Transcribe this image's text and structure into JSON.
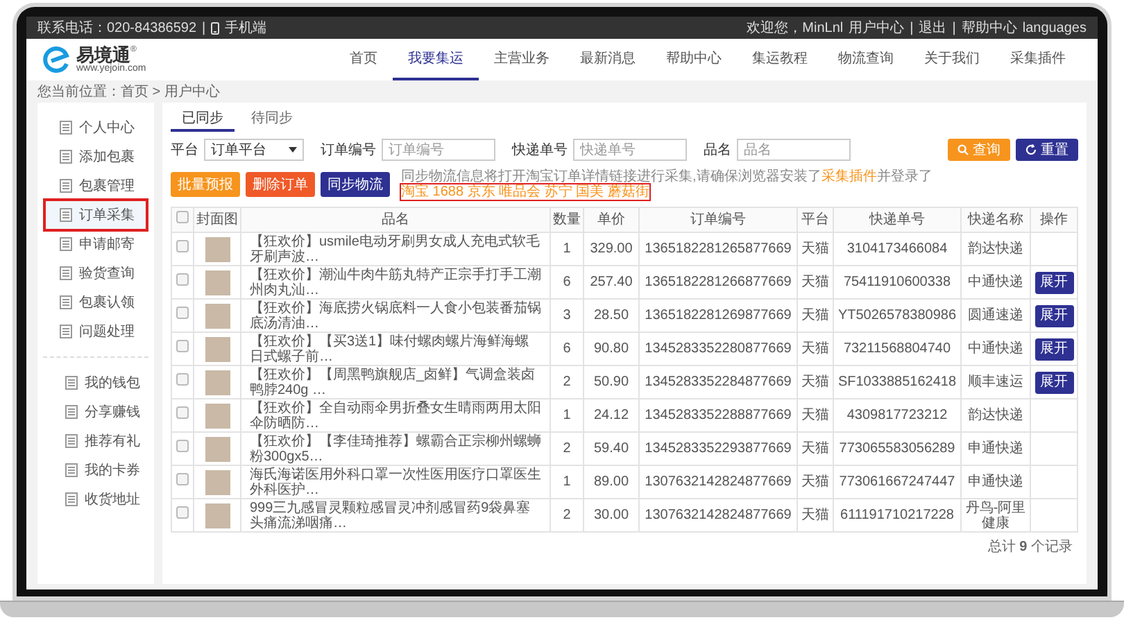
{
  "top_bar": {
    "contact": "联系电话：020-84386592",
    "separator": "|",
    "mobile": "手机端",
    "welcome": "欢迎您，MinLnl",
    "links": [
      {
        "label": "用户中心"
      },
      {
        "label": "退出"
      },
      {
        "label": "帮助中心"
      }
    ],
    "languages": "languages"
  },
  "logo": {
    "name": "易境通",
    "registered": "®",
    "url": "www.yejoin.com"
  },
  "nav": [
    {
      "label": "首页",
      "selected": false
    },
    {
      "label": "我要集运",
      "selected": true
    },
    {
      "label": "主营业务",
      "selected": false
    },
    {
      "label": "最新消息",
      "selected": false
    },
    {
      "label": "帮助中心",
      "selected": false
    },
    {
      "label": "集运教程",
      "selected": false
    },
    {
      "label": "物流查询",
      "selected": false
    },
    {
      "label": "关于我们",
      "selected": false
    },
    {
      "label": "采集插件",
      "selected": false
    }
  ],
  "breadcrumb": "您当前位置：首页 > 用户中心",
  "sidebar": {
    "groups": [
      [
        {
          "label": "个人中心",
          "selected": false
        },
        {
          "label": "添加包裹",
          "selected": false
        },
        {
          "label": "包裹管理",
          "selected": false
        },
        {
          "label": "订单采集",
          "selected": true
        },
        {
          "label": "申请邮寄",
          "selected": false
        },
        {
          "label": "验货查询",
          "selected": false
        },
        {
          "label": "包裹认领",
          "selected": false
        },
        {
          "label": "问题处理",
          "selected": false
        }
      ],
      [
        {
          "label": "我的钱包",
          "selected": false
        },
        {
          "label": "分享赚钱",
          "selected": false
        },
        {
          "label": "推荐有礼",
          "selected": false
        },
        {
          "label": "我的卡券",
          "selected": false
        },
        {
          "label": "收货地址",
          "selected": false
        }
      ]
    ]
  },
  "tabs": [
    {
      "label": "已同步",
      "selected": true
    },
    {
      "label": "待同步",
      "selected": false
    }
  ],
  "filters": {
    "platform": {
      "label": "平台",
      "value": "订单平台"
    },
    "fields": [
      {
        "label": "订单编号",
        "placeholder": "订单编号"
      },
      {
        "label": "快递单号",
        "placeholder": "快递单号"
      },
      {
        "label": "品名",
        "placeholder": "品名"
      }
    ],
    "search_button": "查询",
    "reset_button": "重置"
  },
  "actions": [
    {
      "label": "批量预报",
      "color": "#f7941d"
    },
    {
      "label": "删除订单",
      "color": "#f05a28"
    },
    {
      "label": "同步物流",
      "color": "#2e3192"
    }
  ],
  "note": {
    "text": "同步物流信息将打开淘宝订单详情链接进行采集,请确保浏览器安装了",
    "link": "采集插件",
    "text_2": "并登录了",
    "platforms": "淘宝 1688 京东 唯品会 苏宁 国美 蘑菇街"
  },
  "table": {
    "columns": [
      "封面图",
      "品名",
      "数量",
      "单价",
      "订单编号",
      "平台",
      "快递单号",
      "快递名称",
      "操作"
    ],
    "header_checked": false,
    "rows": [
      {
        "checked": false,
        "name": "【狂欢价】usmile电动牙刷男女成人充电式软毛牙刷声波…",
        "qty": "1",
        "price": "329.00",
        "order_no": "1365182281265877669",
        "platform": "天猫",
        "tracking": "3104173466084",
        "courier": "韵达快递"
      },
      {
        "checked": false,
        "name": "【狂欢价】潮汕牛肉牛筋丸特产正宗手打手工潮州肉丸汕…",
        "qty": "6",
        "price": "257.40",
        "order_no": "1365182281266877669",
        "platform": "天猫",
        "tracking": "75411910600338",
        "courier": "中通快递",
        "action": "展开"
      },
      {
        "checked": false,
        "name": "【狂欢价】海底捞火锅底料一人食小包装番茄锅底汤清油…",
        "qty": "3",
        "price": "28.50",
        "order_no": "1365182281269877669",
        "platform": "天猫",
        "tracking": "YT5026578380986",
        "courier": "圆通速递",
        "action": "展开"
      },
      {
        "checked": false,
        "name": "【狂欢价】【买3送1】味付螺肉螺片海鲜海螺日式螺子前…",
        "qty": "6",
        "price": "90.80",
        "order_no": "1345283352280877669",
        "platform": "天猫",
        "tracking": "73211568804740",
        "courier": "中通快递",
        "action": "展开"
      },
      {
        "checked": false,
        "name": "【狂欢价】【周黑鸭旗舰店_卤鲜】气调盒装卤鸭脖240g …",
        "qty": "2",
        "price": "50.90",
        "order_no": "1345283352284877669",
        "platform": "天猫",
        "tracking": "SF1033885162418",
        "courier": "顺丰速运",
        "action": "展开"
      },
      {
        "checked": false,
        "name": "【狂欢价】全自动雨伞男折叠女生晴雨两用太阳伞防晒防…",
        "qty": "1",
        "price": "24.12",
        "order_no": "1345283352288877669",
        "platform": "天猫",
        "tracking": "4309817723212",
        "courier": "韵达快递"
      },
      {
        "checked": false,
        "name": "【狂欢价】【李佳琦推荐】螺霸合正宗柳州螺蛳粉300gx5…",
        "qty": "2",
        "price": "59.40",
        "order_no": "1345283352293877669",
        "platform": "天猫",
        "tracking": "773065583056289",
        "courier": "申通快递"
      },
      {
        "checked": false,
        "name": "海氏海诺医用外科口罩一次性医用医疗口罩医生外科医护…",
        "qty": "1",
        "price": "89.00",
        "order_no": "1307632142824877669",
        "platform": "天猫",
        "tracking": "773061667247447",
        "courier": "申通快递"
      },
      {
        "checked": false,
        "name": "999三九感冒灵颗粒感冒灵冲剂感冒药9袋鼻塞头痛流涕咽痛…",
        "qty": "2",
        "price": "30.00",
        "order_no": "1307632142824877669",
        "platform": "天猫",
        "tracking": "611191710217228",
        "courier": "丹鸟-阿里健康"
      }
    ]
  },
  "footer": "总计 **9** 个记录"
}
